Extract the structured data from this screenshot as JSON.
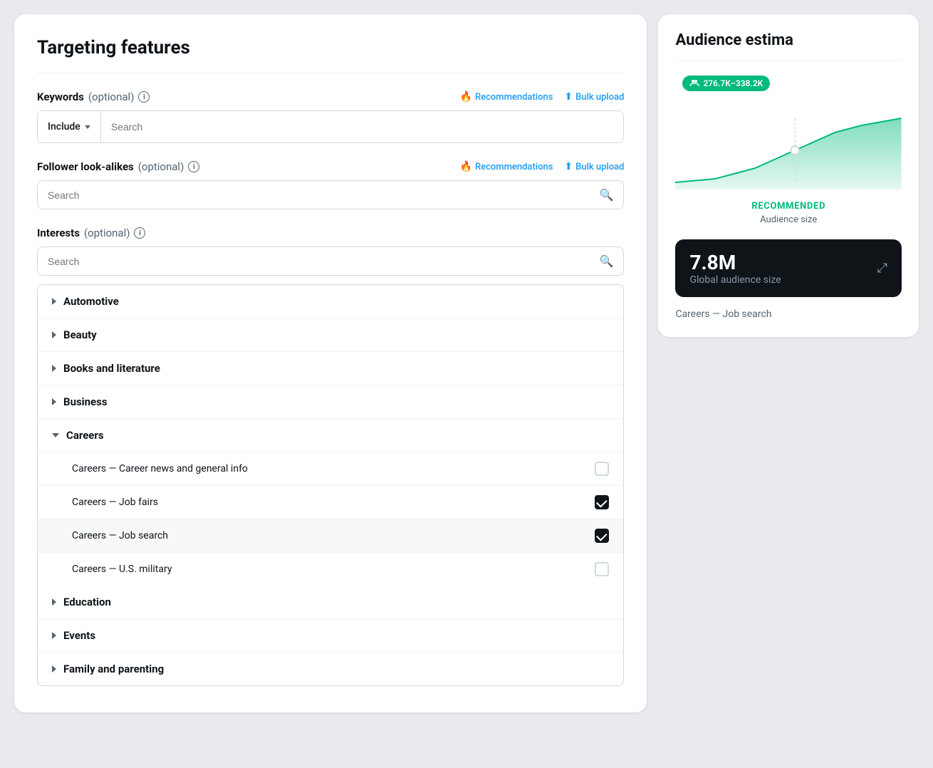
{
  "left_panel": {
    "title": "Targeting features",
    "keywords": {
      "label": "Keywords",
      "optional_label": "(optional)",
      "info": "i",
      "recommendations_label": "Recommendations",
      "bulk_upload_label": "Bulk upload",
      "include_dropdown_label": "Include",
      "search_placeholder": "Search"
    },
    "follower_lookalikes": {
      "label": "Follower look-alikes",
      "optional_label": "(optional)",
      "info": "i",
      "recommendations_label": "Recommendations",
      "bulk_upload_label": "Bulk upload",
      "search_placeholder": "Search"
    },
    "interests": {
      "label": "Interests",
      "optional_label": "(optional)",
      "info": "i",
      "search_placeholder": "Search",
      "categories": [
        {
          "name": "Automotive",
          "expanded": false,
          "subcategories": []
        },
        {
          "name": "Beauty",
          "expanded": false,
          "subcategories": []
        },
        {
          "name": "Books and literature",
          "expanded": false,
          "subcategories": []
        },
        {
          "name": "Business",
          "expanded": false,
          "subcategories": []
        },
        {
          "name": "Careers",
          "expanded": true,
          "subcategories": [
            {
              "name": "Careers — Career news and general info",
              "checked": false
            },
            {
              "name": "Careers — Job fairs",
              "checked": true
            },
            {
              "name": "Careers — Job search",
              "checked": true
            },
            {
              "name": "Careers — U.S. military",
              "checked": false
            }
          ]
        },
        {
          "name": "Education",
          "expanded": false,
          "subcategories": []
        },
        {
          "name": "Events",
          "expanded": false,
          "subcategories": []
        },
        {
          "name": "Family and parenting",
          "expanded": false,
          "subcategories": []
        }
      ]
    }
  },
  "right_panel": {
    "title": "Audience estima",
    "badge_text": "276.7K–338.2K",
    "recommended_label": "RECOMMENDED",
    "audience_size_label": "Audience size",
    "global_audience": {
      "number": "7.8M",
      "label": "Global audience size"
    },
    "career_tag": "Careers — Job search"
  }
}
